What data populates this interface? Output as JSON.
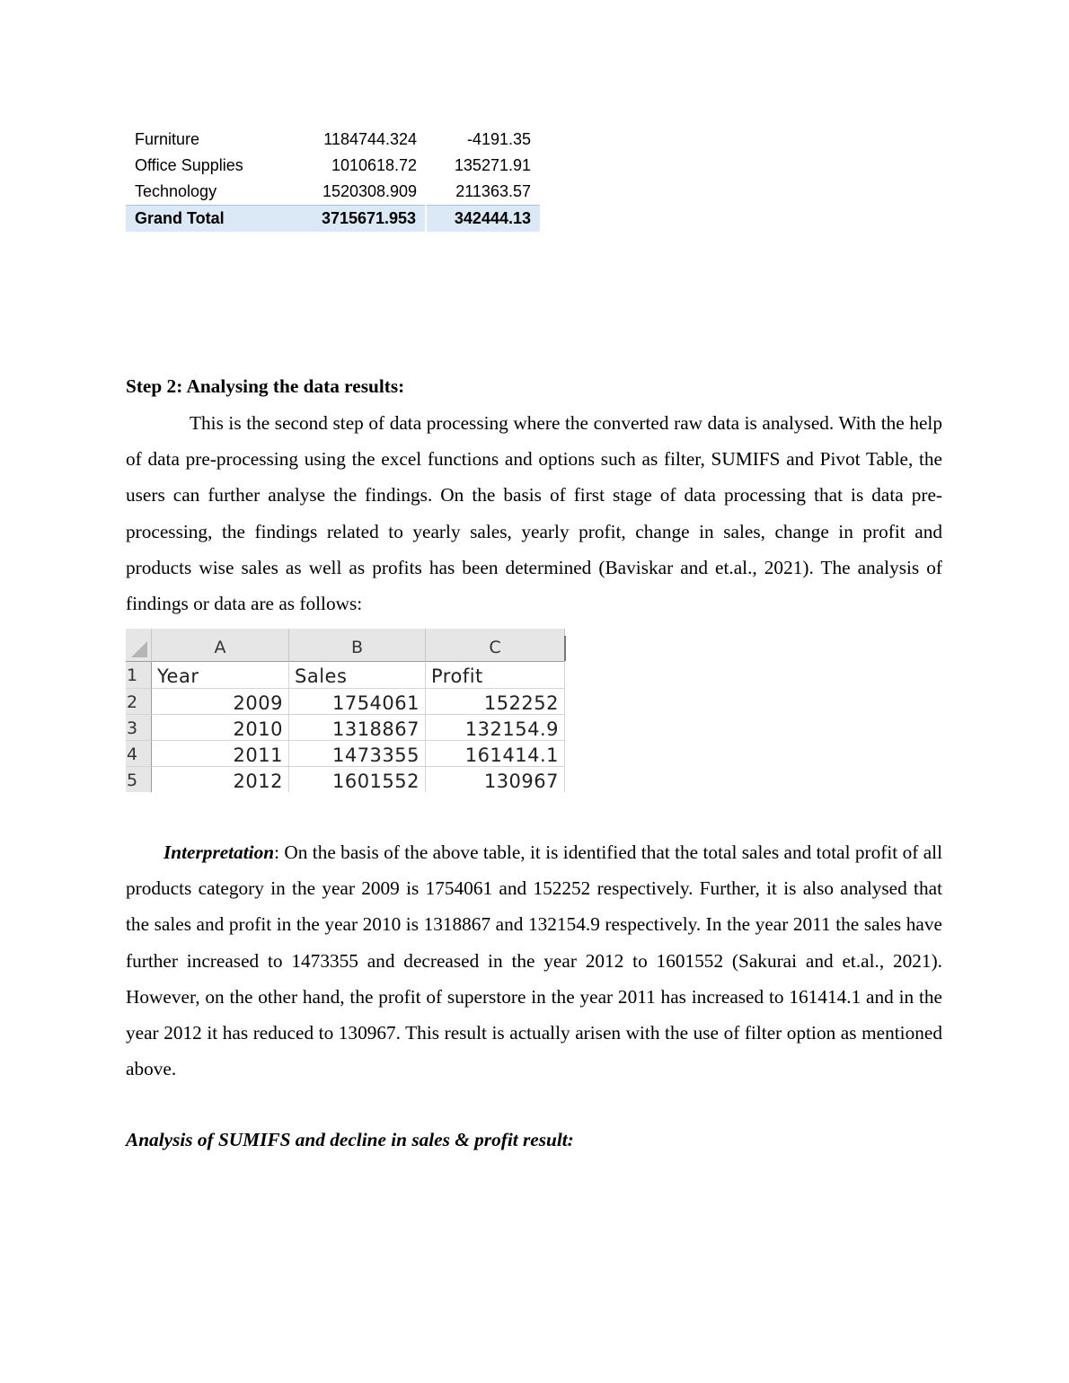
{
  "pivot_table": {
    "rows": [
      {
        "category": "Furniture",
        "sales": "1184744.324",
        "profit": "-4191.35"
      },
      {
        "category": "Office Supplies",
        "sales": "1010618.72",
        "profit": "135271.91"
      },
      {
        "category": "Technology",
        "sales": "1520308.909",
        "profit": "211363.57"
      }
    ],
    "total": {
      "category": "Grand Total",
      "sales": "3715671.953",
      "profit": "342444.13"
    },
    "total_bg_color": "#dbe8f5"
  },
  "step2": {
    "heading": "Step 2: Analysing the data results:",
    "paragraph": "This is the second step of data processing where the converted raw data is analysed. With the help of data pre-processing using the excel functions and options such as filter, SUMIFS and Pivot Table, the users can further analyse the findings. On the basis of first stage of data processing that is data pre-processing, the findings related to yearly sales, yearly profit, change in sales, change in profit and products wise sales as well as profits has been determined (Baviskar and et.al., 2021). The analysis of findings or data are as follows:"
  },
  "excel_table": {
    "column_letters": [
      "A",
      "B",
      "C"
    ],
    "row_numbers": [
      "1",
      "2",
      "3",
      "4",
      "5"
    ],
    "headers": [
      "Year",
      "Sales",
      "Profit"
    ],
    "rows": [
      [
        "2009",
        "1754061",
        "152252"
      ],
      [
        "2010",
        "1318867",
        "132154.9"
      ],
      [
        "2011",
        "1473355",
        "161414.1"
      ],
      [
        "2012",
        "1601552",
        "130967"
      ]
    ]
  },
  "interpretation": {
    "lead": "Interpretation",
    "text": ": On the basis of the above table, it is identified that the total sales and total profit of all products category in the year 2009 is 1754061 and 152252 respectively. Further, it is also analysed that the sales and profit in the year 2010 is 1318867 and 132154.9 respectively. In the year 2011 the sales have further increased to 1473355 and decreased in the year 2012 to 1601552 (Sakurai and et.al., 2021). However, on the other hand, the profit of superstore in the year 2011 has increased to 161414.1 and in the year 2012 it has reduced to 130967. This result is actually arisen with the use of filter option as mentioned above."
  },
  "subheading": "Analysis of SUMIFS and decline in sales & profit result:"
}
